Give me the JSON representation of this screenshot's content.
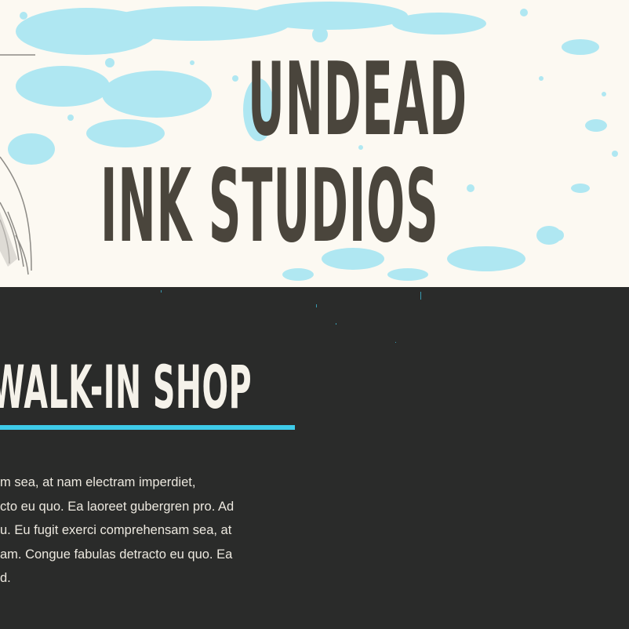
{
  "hero": {
    "title_line1": "UNDEAD",
    "title_line2": "INK STUDIOS"
  },
  "section": {
    "title": "WALK-IN SHOP",
    "paragraph_lines": [
      "m sea, at nam electram imperdiet,",
      "cto eu quo. Ea laoreet gubergren pro. Ad",
      "u. Eu fugit exerci comprehensam sea, at",
      "am. Congue fabulas detracto eu quo. Ea",
      "d."
    ]
  },
  "colors": {
    "accent": "#3ecbe9",
    "hero_background": "#fcf9f2",
    "title_text": "#4a453c",
    "dark_background": "#2a2b2a",
    "light_text": "#f5f2ea"
  }
}
